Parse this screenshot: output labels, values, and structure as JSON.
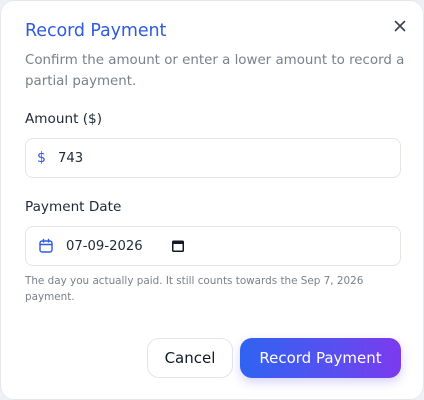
{
  "dialog": {
    "title": "Record Payment",
    "description": "Confirm the amount or enter a lower amount to record a partial payment.",
    "close_icon": "close-icon"
  },
  "amount": {
    "label": "Amount ($)",
    "prefix": "$",
    "value": "743"
  },
  "payment_date": {
    "label": "Payment Date",
    "value": "07-09-2026",
    "icon": "calendar-icon",
    "help": "The day you actually paid. It still counts towards the Sep 7, 2026 payment."
  },
  "actions": {
    "cancel_label": "Cancel",
    "submit_label": "Record Payment"
  },
  "colors": {
    "accent": "#2f5be0",
    "primary_gradient_start": "#2f63f2",
    "primary_gradient_end": "#7c3aed"
  }
}
